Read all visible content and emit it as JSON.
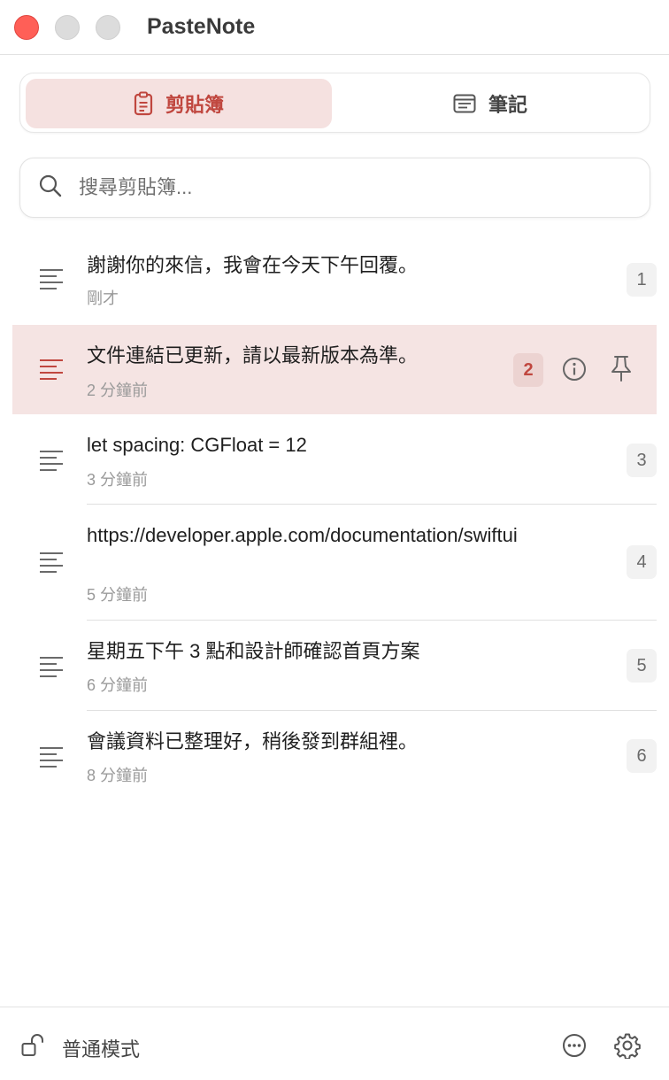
{
  "app": {
    "title": "PasteNote"
  },
  "tabs": {
    "clipboard": "剪貼簿",
    "notes": "筆記"
  },
  "search": {
    "placeholder": "搜尋剪貼簿..."
  },
  "items": [
    {
      "title": "謝謝你的來信，我會在今天下午回覆。",
      "time": "剛才",
      "index": "1"
    },
    {
      "title": "文件連結已更新，請以最新版本為準。",
      "time": "2 分鐘前",
      "index": "2"
    },
    {
      "title": "let spacing: CGFloat = 12",
      "time": "3 分鐘前",
      "index": "3"
    },
    {
      "title": "https://developer.apple.com/documentation/swiftui",
      "time": "5 分鐘前",
      "index": "4"
    },
    {
      "title": "星期五下午 3 點和設計師確認首頁方案",
      "time": "6 分鐘前",
      "index": "5"
    },
    {
      "title": "會議資料已整理好，稍後發到群組裡。",
      "time": "8 分鐘前",
      "index": "6"
    }
  ],
  "footer": {
    "mode_label": "普通模式"
  },
  "colors": {
    "accent": "#c0473f",
    "selected_bg": "#f5e4e3",
    "close": "#ff5f57"
  }
}
